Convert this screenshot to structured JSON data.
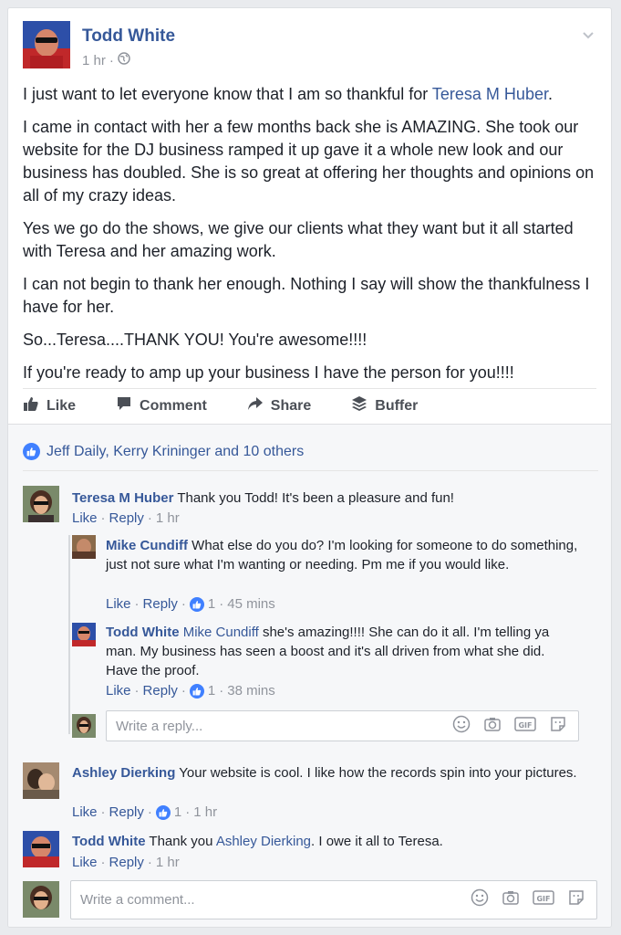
{
  "post": {
    "author": "Todd White",
    "time": "1 hr",
    "dot": "·",
    "paragraphs": [
      {
        "before": "I just want to let everyone know that I am so thankful for ",
        "link": "Teresa M Huber",
        "after": "."
      },
      {
        "text": "I came in contact with her a few months back she is AMAZING. She took our website for the DJ business ramped it up gave it a whole new look and our business has doubled. She is so great at offering her thoughts and opinions on all of my crazy ideas."
      },
      {
        "text": "Yes we go do the shows, we give our clients what they want but it all started with Teresa and her amazing work."
      },
      {
        "text": "I can not begin to thank her enough. Nothing I say will show the thankfulness I have for her."
      },
      {
        "text": "So...Teresa....THANK YOU! You're awesome!!!!"
      },
      {
        "text": "If you're ready to amp up your business I have the person for you!!!!"
      }
    ]
  },
  "actions": {
    "like": "Like",
    "comment": "Comment",
    "share": "Share",
    "buffer": "Buffer"
  },
  "reactions": {
    "summary": "Jeff Daily, Kerry Krininger and 10 others"
  },
  "comments": [
    {
      "author": "Teresa M Huber",
      "text": " Thank you Todd! It's been a pleasure and fun!",
      "like": "Like",
      "reply": "Reply",
      "time": "1 hr"
    },
    {
      "author": "Mike Cundiff",
      "text": " What else do you do? I'm looking for someone to do something, just not sure what I'm wanting or needing. Pm me if you would like.",
      "like": "Like",
      "reply": "Reply",
      "likes": "1",
      "time": "45 mins"
    },
    {
      "author": "Todd White",
      "mention": "Mike Cundiff",
      "text": " she's amazing!!!! She can do it all. I'm telling ya man. My business has seen a boost and it's all driven from what she did. Have the proof.",
      "like": "Like",
      "reply": "Reply",
      "likes": "1",
      "time": "38 mins"
    },
    {
      "author": "Ashley Dierking",
      "text": " Your website is cool. I like how the records spin into your pictures.",
      "like": "Like",
      "reply": "Reply",
      "likes": "1",
      "time": "1 hr"
    },
    {
      "author": "Todd White",
      "before": " Thank you ",
      "mention": "Ashley Dierking",
      "after": ". I owe it all to Teresa.",
      "like": "Like",
      "reply": "Reply",
      "time": "1 hr"
    }
  ],
  "reply_input": {
    "placeholder": "Write a reply..."
  },
  "comment_input": {
    "placeholder": "Write a comment..."
  },
  "gif_label": "GIF",
  "sep": "·",
  "colors": {
    "link": "#365899",
    "like_blue": "#4080ff",
    "muted": "#90949c",
    "background": "#e9ebee"
  }
}
